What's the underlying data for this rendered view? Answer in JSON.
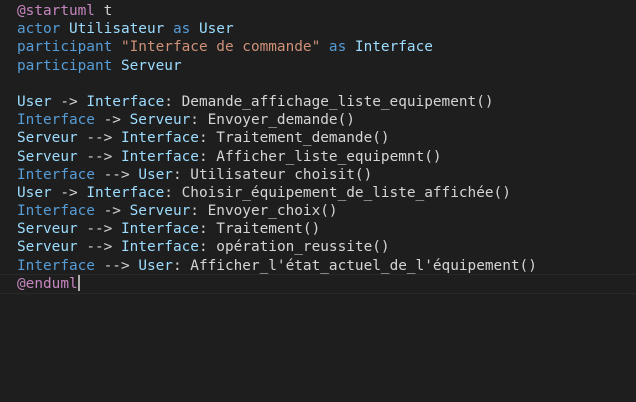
{
  "editor": {
    "lines": [
      [
        {
          "text": "@startuml",
          "kind": "directive"
        },
        {
          "text": " t",
          "kind": "plain"
        }
      ],
      [
        {
          "text": "actor",
          "kind": "keyword"
        },
        {
          "text": " ",
          "kind": "plain"
        },
        {
          "text": "Utilisateur",
          "kind": "ident"
        },
        {
          "text": " as ",
          "kind": "keyword"
        },
        {
          "text": "User",
          "kind": "ident"
        }
      ],
      [
        {
          "text": "participant",
          "kind": "keyword"
        },
        {
          "text": " ",
          "kind": "plain"
        },
        {
          "text": "\"Interface de commande\"",
          "kind": "string"
        },
        {
          "text": " as ",
          "kind": "keyword"
        },
        {
          "text": "Interface",
          "kind": "ident"
        }
      ],
      [
        {
          "text": "participant",
          "kind": "keyword"
        },
        {
          "text": " ",
          "kind": "plain"
        },
        {
          "text": "Serveur",
          "kind": "ident"
        }
      ],
      [],
      [
        {
          "text": "User",
          "kind": "ident"
        },
        {
          "text": " -> ",
          "kind": "plain"
        },
        {
          "text": "Interface",
          "kind": "ident"
        },
        {
          "text": ": Demande_affichage_liste_equipement()",
          "kind": "msg"
        }
      ],
      [
        {
          "text": "Interface",
          "kind": "keyword"
        },
        {
          "text": " -> ",
          "kind": "plain"
        },
        {
          "text": "Serveur",
          "kind": "ident"
        },
        {
          "text": ": Envoyer_demande()",
          "kind": "msg"
        }
      ],
      [
        {
          "text": "Serveur",
          "kind": "ident"
        },
        {
          "text": " --> ",
          "kind": "plain"
        },
        {
          "text": "Interface",
          "kind": "ident"
        },
        {
          "text": ": Traitement_demande()",
          "kind": "msg"
        }
      ],
      [
        {
          "text": "Serveur",
          "kind": "ident"
        },
        {
          "text": " --> ",
          "kind": "plain"
        },
        {
          "text": "Interface",
          "kind": "ident"
        },
        {
          "text": ": Afficher_liste_equipemnt()",
          "kind": "msg"
        }
      ],
      [
        {
          "text": "Interface",
          "kind": "keyword"
        },
        {
          "text": " --> ",
          "kind": "plain"
        },
        {
          "text": "User",
          "kind": "ident"
        },
        {
          "text": ": Utilisateur choisit()",
          "kind": "msg"
        }
      ],
      [
        {
          "text": "User",
          "kind": "ident"
        },
        {
          "text": " -> ",
          "kind": "plain"
        },
        {
          "text": "Interface",
          "kind": "ident"
        },
        {
          "text": ": Choisir_équipement_de_liste_affichée()",
          "kind": "msg"
        }
      ],
      [
        {
          "text": "Interface",
          "kind": "keyword"
        },
        {
          "text": " -> ",
          "kind": "plain"
        },
        {
          "text": "Serveur",
          "kind": "ident"
        },
        {
          "text": ": Envoyer_choix()",
          "kind": "msg"
        }
      ],
      [
        {
          "text": "Serveur",
          "kind": "ident"
        },
        {
          "text": " --> ",
          "kind": "plain"
        },
        {
          "text": "Interface",
          "kind": "ident"
        },
        {
          "text": ": Traitement()",
          "kind": "msg"
        }
      ],
      [
        {
          "text": "Serveur",
          "kind": "ident"
        },
        {
          "text": " --> ",
          "kind": "plain"
        },
        {
          "text": "Interface",
          "kind": "ident"
        },
        {
          "text": ": opération_reussite()",
          "kind": "msg"
        }
      ],
      [
        {
          "text": "Interface",
          "kind": "keyword"
        },
        {
          "text": " --> ",
          "kind": "plain"
        },
        {
          "text": "User",
          "kind": "ident"
        },
        {
          "text": ": Afficher_l'état_actuel_de_l'équipement()",
          "kind": "msg"
        }
      ],
      [
        {
          "text": "@enduml",
          "kind": "directive"
        }
      ]
    ],
    "cursor_line": 15
  },
  "colors": {
    "background": "#1e1e1e",
    "directive": "#c586c0",
    "keyword": "#569cd6",
    "identifier": "#9cdcfe",
    "string": "#ce9178",
    "text": "#d4d4d4"
  }
}
